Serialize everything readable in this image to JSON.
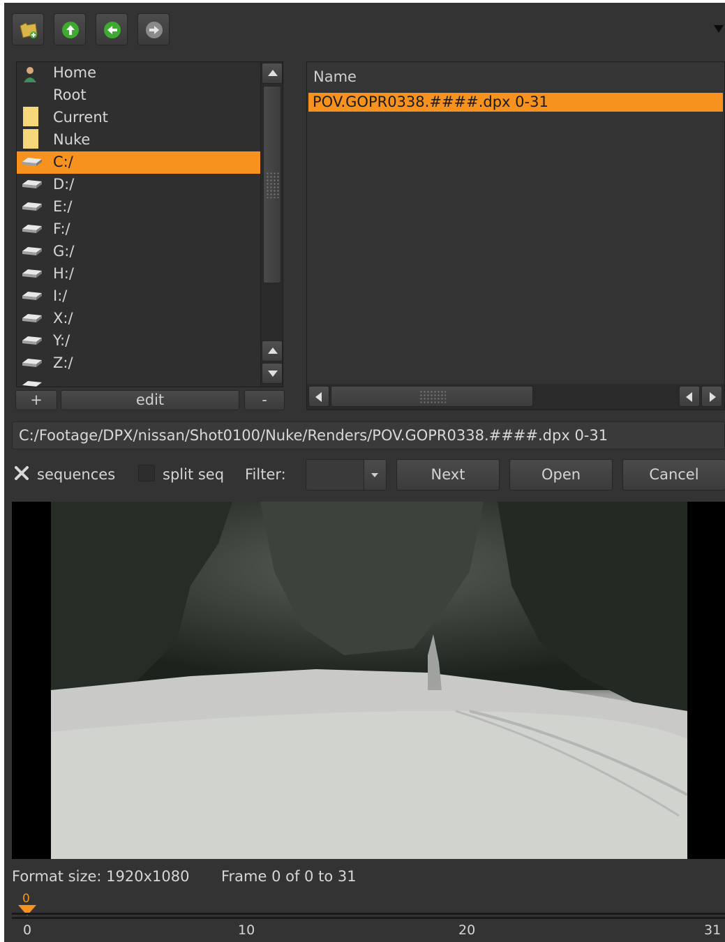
{
  "toolbar": {
    "buttons": [
      {
        "name": "new-folder",
        "icon": "new-folder-icon"
      },
      {
        "name": "up",
        "icon": "arrow-up-icon"
      },
      {
        "name": "back",
        "icon": "arrow-left-icon"
      },
      {
        "name": "forward",
        "icon": "arrow-right-icon"
      }
    ]
  },
  "favorites": {
    "items": [
      {
        "label": "Home",
        "icon": "home-user-icon"
      },
      {
        "label": "Root",
        "icon": ""
      },
      {
        "label": "Current",
        "icon": "folder-icon"
      },
      {
        "label": "Nuke",
        "icon": "folder-icon"
      },
      {
        "label": "C:/",
        "icon": "drive-icon",
        "selected": true
      },
      {
        "label": "D:/",
        "icon": "drive-icon"
      },
      {
        "label": "E:/",
        "icon": "drive-icon"
      },
      {
        "label": "F:/",
        "icon": "drive-icon"
      },
      {
        "label": "G:/",
        "icon": "drive-icon"
      },
      {
        "label": "H:/",
        "icon": "drive-icon"
      },
      {
        "label": "I:/",
        "icon": "drive-icon"
      },
      {
        "label": "X:/",
        "icon": "drive-icon"
      },
      {
        "label": "Y:/",
        "icon": "drive-icon"
      },
      {
        "label": "Z:/",
        "icon": "drive-icon"
      }
    ],
    "add_label": "+",
    "edit_label": "edit",
    "remove_label": "-"
  },
  "files": {
    "column_header": "Name",
    "rows": [
      {
        "name": "POV.GOPR0338.####.dpx 0-31",
        "selected": true
      }
    ]
  },
  "path": {
    "value": "C:/Footage/DPX/nissan/Shot0100/Nuke/Renders/POV.GOPR0338.####.dpx 0-31"
  },
  "options": {
    "sequences_label": "sequences",
    "sequences_checked": true,
    "split_seq_label": "split seq",
    "split_seq_checked": false,
    "filter_label": "Filter:",
    "filter_value": ""
  },
  "actions": {
    "next_label": "Next",
    "open_label": "Open",
    "cancel_label": "Cancel"
  },
  "status": {
    "format": "Format size: 1920x1080",
    "frame": "Frame 0 of 0 to 31"
  },
  "timeline": {
    "current_frame": "0",
    "ticks": [
      "0",
      "10",
      "20",
      "31"
    ]
  },
  "colors": {
    "accent": "#f7921e",
    "background": "#333333"
  }
}
